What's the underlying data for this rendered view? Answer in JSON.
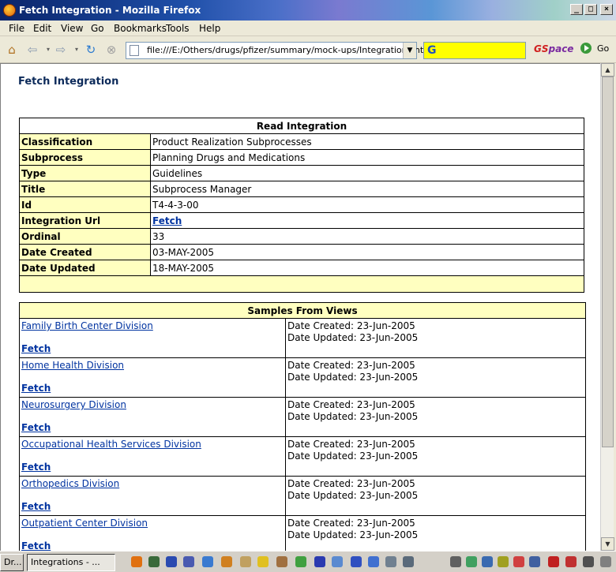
{
  "window": {
    "title": "Fetch Integration - Mozilla Firefox"
  },
  "menu": [
    "File",
    "Edit",
    "View",
    "Go",
    "Bookmarks",
    "Tools",
    "Help"
  ],
  "toolbar": {
    "url": "file:///E:/Others/drugs/pfizer/summary/mock-ups/Integrations.htm",
    "gspace_g": "GS",
    "gspace_rest": "pace",
    "go_label": "Go"
  },
  "page": {
    "title": "Fetch Integration",
    "read_header": "Read Integration",
    "fields": [
      {
        "label": "Classification",
        "value": "Product Realization Subprocesses",
        "link": false
      },
      {
        "label": "Subprocess",
        "value": "Planning Drugs and Medications",
        "link": false
      },
      {
        "label": "Type",
        "value": "Guidelines",
        "link": false
      },
      {
        "label": "Title",
        "value": "Subprocess Manager",
        "link": false
      },
      {
        "label": "Id",
        "value": "T4-4-3-00",
        "link": false
      },
      {
        "label": "Integration Url",
        "value": "Fetch",
        "link": true
      },
      {
        "label": "Ordinal",
        "value": "33",
        "link": false
      },
      {
        "label": "Date Created",
        "value": "03-MAY-2005",
        "link": false
      },
      {
        "label": "Date Updated",
        "value": "18-MAY-2005",
        "link": false
      }
    ],
    "samples_header": "Samples From Views",
    "samples": [
      {
        "name": "Family Birth Center Division",
        "fetch": "Fetch",
        "created": "Date Created: 23-Jun-2005",
        "updated": "Date Updated: 23-Jun-2005"
      },
      {
        "name": "Home Health Division",
        "fetch": "Fetch",
        "created": "Date Created: 23-Jun-2005",
        "updated": "Date Updated: 23-Jun-2005"
      },
      {
        "name": "Neurosurgery Division",
        "fetch": "Fetch",
        "created": "Date Created: 23-Jun-2005",
        "updated": "Date Updated: 23-Jun-2005"
      },
      {
        "name": "Occupational Health Services Division",
        "fetch": "Fetch",
        "created": "Date Created: 23-Jun-2005",
        "updated": "Date Updated: 23-Jun-2005"
      },
      {
        "name": "Orthopedics Division",
        "fetch": "Fetch",
        "created": "Date Created: 23-Jun-2005",
        "updated": "Date Updated: 23-Jun-2005"
      },
      {
        "name": "Outpatient Center Division",
        "fetch": "Fetch",
        "created": "Date Created: 23-Jun-2005",
        "updated": "Date Updated: 23-Jun-2005"
      }
    ]
  },
  "taskbar": {
    "task1": "Dr...",
    "task2": "Integrations - ..."
  }
}
